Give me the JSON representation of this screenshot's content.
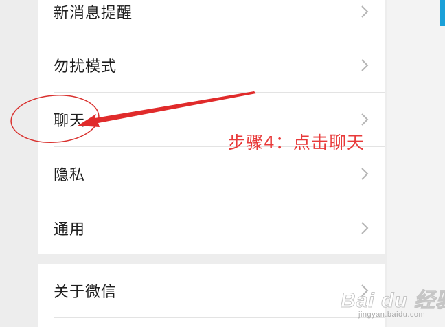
{
  "settings": {
    "items": [
      {
        "label": "新消息提醒"
      },
      {
        "label": "勿扰模式"
      },
      {
        "label": "聊天"
      },
      {
        "label": "隐私"
      },
      {
        "label": "通用"
      }
    ],
    "about": {
      "label": "关于微信"
    }
  },
  "annotation": {
    "text": "步骤4：点击聊天",
    "color": "#e83a3a"
  },
  "watermark": {
    "main": "Bai du 经验",
    "sub": "jingyan.baidu.com"
  },
  "colors": {
    "background": "#ededed",
    "panel": "#ffffff",
    "divider": "#e3e3e3",
    "chevron": "#b5b5b5",
    "accent": "#1aa0d8"
  }
}
